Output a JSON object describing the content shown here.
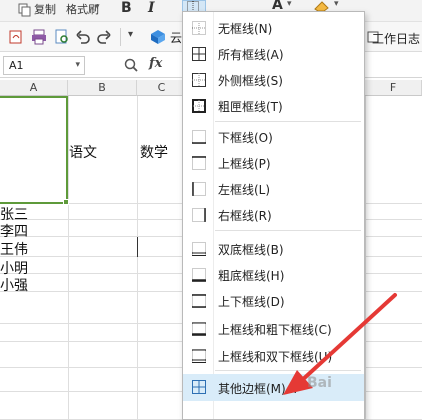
{
  "ribbon": {
    "copy_label": "复制",
    "format_painter_label": "格式刷",
    "bold": "B",
    "italic": "I",
    "font_color_letter": "A"
  },
  "quick": {
    "cloud_label": "云",
    "tab_work_log": "工作日志"
  },
  "formula_bar": {
    "name_box": "A1",
    "fx": "fx"
  },
  "columns": [
    "A",
    "B",
    "C",
    "F"
  ],
  "cells": {
    "b_header": "语文",
    "c_header": "数学",
    "names": [
      "张三",
      "李四",
      "王伟",
      "小明",
      "小强"
    ]
  },
  "menu": {
    "items": [
      {
        "label": "无框线(N)"
      },
      {
        "label": "所有框线(A)"
      },
      {
        "label": "外侧框线(S)"
      },
      {
        "label": "粗匣框线(T)"
      },
      {
        "label": "下框线(O)"
      },
      {
        "label": "上框线(P)"
      },
      {
        "label": "左框线(L)"
      },
      {
        "label": "右框线(R)"
      },
      {
        "label": "双底框线(B)"
      },
      {
        "label": "粗底框线(H)"
      },
      {
        "label": "上下框线(D)"
      },
      {
        "label": "上框线和粗下框线(C)"
      },
      {
        "label": "上框线和双下框线(U)"
      },
      {
        "label": "其他边框(M)..."
      }
    ]
  },
  "colors": {
    "selection": "#5e9a3a",
    "menu_highlight": "#d9ecf9",
    "arrow": "#e53935"
  },
  "watermark": "Bai"
}
